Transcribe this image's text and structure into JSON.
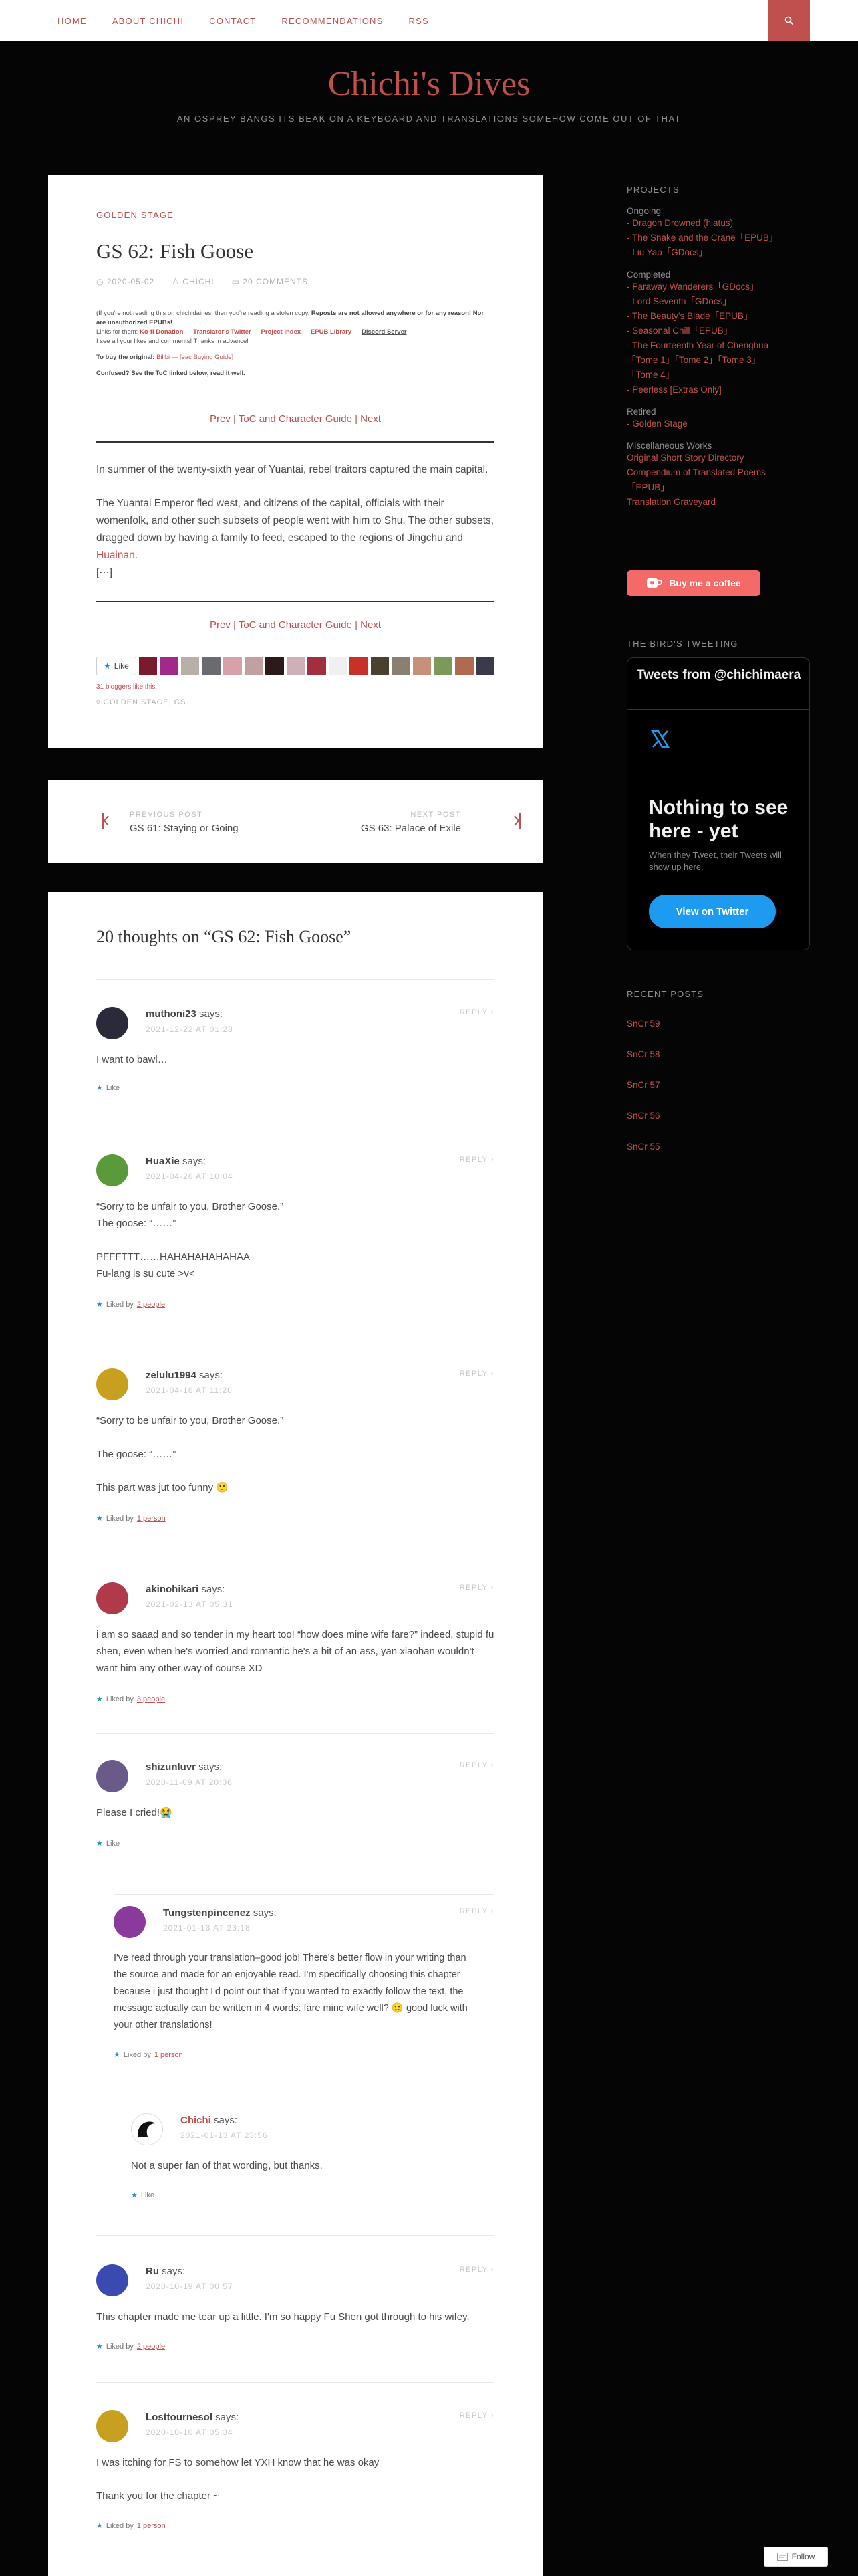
{
  "nav": {
    "items": [
      "HOME",
      "ABOUT CHICHI",
      "CONTACT",
      "RECOMMENDATIONS",
      "RSS"
    ]
  },
  "header": {
    "title": "Chichi's Dives",
    "tagline": "AN OSPREY BANGS ITS BEAK ON A KEYBOARD AND TRANSLATIONS SOMEHOW COME OUT OF THAT"
  },
  "post": {
    "category": "GOLDEN STAGE",
    "title": "GS 62: Fish Goose",
    "date": "2020-05-02",
    "author": "CHICHI",
    "comments_count": "20 COMMENTS",
    "notice_line1a": "(If you're not reading this on chichidaines, then you're reading a stolen copy. ",
    "notice_line1b": "Reposts are not allowed anywhere or for any reason! Nor are unauthorized EPUBs!",
    "notice_line2a": "Links for them: ",
    "notice_links": "Ko-fi Donation — Translator's Twitter — Project Index — EPUB Library — ",
    "notice_discord": "Discord Server",
    "notice_line3": "I see all your likes and comments! Thanks in advance!",
    "buy_label": "To buy the original: ",
    "buy_link": "Bilibi — [eac Buying Guide]",
    "confused": "Confused? See the ToC linked below, read it well.",
    "nav_line": "Prev | ToC and Character Guide | Next",
    "para1": "In summer of the twenty-sixth year of Yuantai, rebel traitors captured the main capital.",
    "para2a": "The Yuantai Emperor fled west, and citizens of the capital, officials with their womenfolk, and other such subsets of people went with him to Shu. The other subsets, dragged down by having a family to feed, escaped to the regions of Jingchu and ",
    "para2_link": "Huainan",
    "para2b": ".",
    "ellipsis": "[⋯]",
    "like_label": "Like",
    "likers": "31 bloggers like this.",
    "tags": "GOLDEN STAGE, GS"
  },
  "postnav": {
    "prev_kicker": "PREVIOUS POST",
    "prev_title": "GS 61: Staying or Going",
    "next_kicker": "NEXT POST",
    "next_title": "GS 63: Palace of Exile"
  },
  "comments": {
    "heading": "20 thoughts on “GS 62: Fish Goose”",
    "reply_label": "REPLY",
    "items": [
      {
        "author": "muthoni23",
        "says": " says:",
        "date": "2021-12-22 AT 01:28",
        "body": [
          "I want to bawl…"
        ],
        "like": "Like",
        "liked_by": "",
        "color": "#2a2a3a"
      },
      {
        "author": "HuaXie",
        "says": " says:",
        "date": "2021-04-26 AT 10:04",
        "body": [
          "“Sorry to be unfair to you, Brother Goose.”",
          "The goose: “……”",
          "",
          "PFFFTTT……HAHAHAHAHAHAA",
          "Fu-lang is su cute >v<"
        ],
        "like": "Liked by ",
        "liked_by": "2 people",
        "color": "#5a9a3a"
      },
      {
        "author": "zelulu1994",
        "says": " says:",
        "date": "2021-04-16 AT 11:20",
        "body": [
          "“Sorry to be unfair to you, Brother Goose.”",
          "",
          "The goose: “……”",
          "",
          "This part was jut too funny 🙂"
        ],
        "like": "Liked by ",
        "liked_by": "1 person",
        "color": "#c8a020"
      },
      {
        "author": "akinohikari",
        "says": " says:",
        "date": "2021-02-13 AT 05:31",
        "body": [
          "i am so saaad and so tender in my heart too! “how does mine wife fare?” indeed, stupid fu",
          "shen, even when he's worried and romantic he's a bit of an ass, yan xiaohan wouldn't",
          "want him any other way of course XD"
        ],
        "like": "Liked by ",
        "liked_by": "3 people",
        "color": "#b03a4a"
      },
      {
        "author": "shizunluvr",
        "says": " says:",
        "date": "2020-11-09 AT 20:06",
        "body": [
          "Please I cried!😭"
        ],
        "like": "Like",
        "liked_by": "",
        "color": "#6a5a8a"
      },
      {
        "author": "Tungstenpincenez",
        "says": " says:",
        "date": "2021-01-13 AT 23:18",
        "body": [
          "I've read through your translation–good job! There's better flow in your writing than",
          "the source and made for an enjoyable read. I'm specifically choosing this chapter",
          "because i just thought I'd point out that if you wanted to exactly follow the text, the",
          "message actually can be written in 4 words: fare mine wife well? 🙂 good luck with",
          "your other translations!"
        ],
        "like": "Liked by ",
        "liked_by": "1 person",
        "color": "#8a3a9a"
      },
      {
        "author": "Chichi",
        "says": " says:",
        "date": "2021-01-13 AT 23:56",
        "body": [
          "Not a super fan of that wording, but thanks."
        ],
        "like": "Like",
        "liked_by": "",
        "color": "#ffffff"
      },
      {
        "author": "Ru",
        "says": " says:",
        "date": "2020-10-19 AT 00:57",
        "body": [
          "This chapter made me tear up a little. I'm so happy Fu Shen got through to his wifey."
        ],
        "like": "Liked by ",
        "liked_by": "2 people",
        "color": "#3a4ab0"
      },
      {
        "author": "Losttournesol",
        "says": " says:",
        "date": "2020-10-10 AT 05:34",
        "body": [
          "I was itching for FS to somehow let YXH know that he was okay",
          "",
          "Thank you for the chapter ~"
        ],
        "like": "Liked by ",
        "liked_by": "1 person",
        "color": "#c8a020"
      }
    ]
  },
  "sidebar": {
    "projects_heading": "PROJECTS",
    "ongoing_label": "Ongoing",
    "ongoing": [
      "- Dragon Drowned (hiatus)",
      "- The Snake and the Crane「EPUB」",
      "- Liu Yao「GDocs」"
    ],
    "completed_label": "Completed",
    "completed": [
      "- Faraway Wanderers「GDocs」",
      "- Lord Seventh「GDocs」",
      "- The Beauty's Blade「EPUB」",
      "- Seasonal Chill「EPUB」",
      "- The Fourteenth Year of Chenghua",
      "「Tome 1」「Tome 2」「Tome 3」",
      "「Tome 4」",
      "- Peerless [Extras Only]"
    ],
    "retired_label": "Retired",
    "retired": [
      "- Golden Stage"
    ],
    "misc_label": "Miscellaneous Works",
    "misc": [
      "Original Short Story Directory",
      "Compendium of Translated Poems",
      "「EPUB」",
      "Translation Graveyard"
    ],
    "coffee_label": "Buy me a coffee",
    "birds_heading": "THE BIRD'S TWEETING",
    "tw_head": "Tweets from @chichimaera",
    "tw_big": "Nothing to see here - yet",
    "tw_small": "When they Tweet, their Tweets will show up here.",
    "tw_btn": "View on Twitter",
    "recent_heading": "RECENT POSTS",
    "recent": [
      "SnCr 59",
      "SnCr 58",
      "SnCr 57",
      "SnCr 56",
      "SnCr 55"
    ]
  },
  "follow_label": "Follow"
}
